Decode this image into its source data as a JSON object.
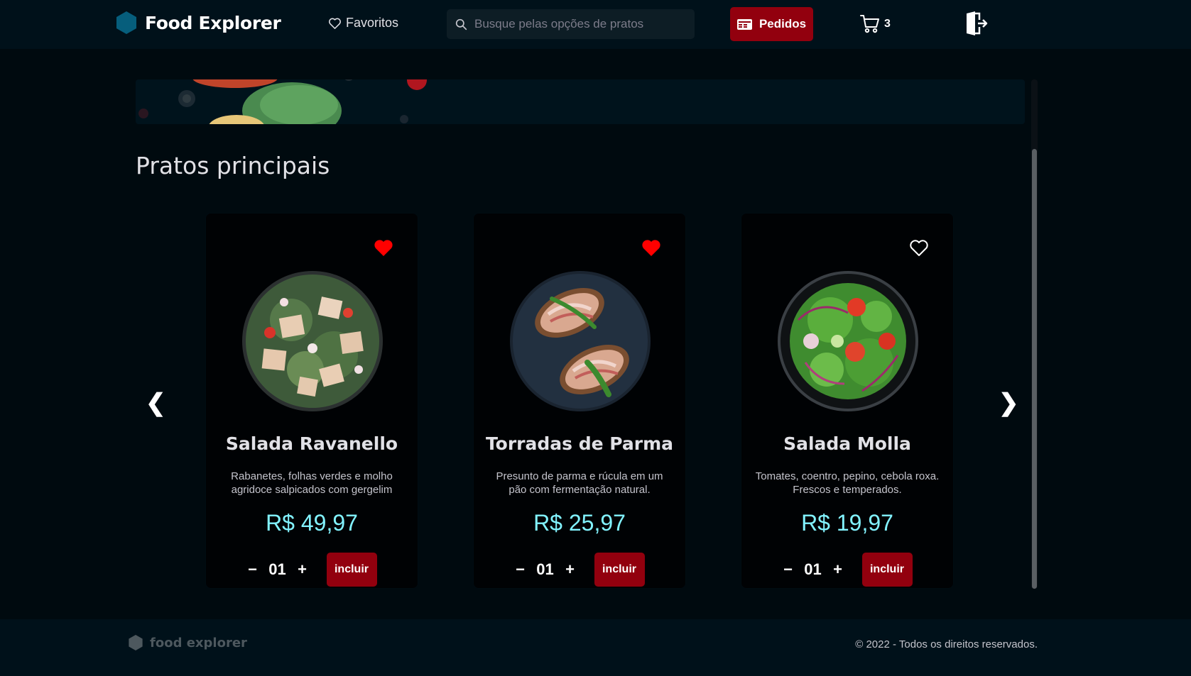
{
  "header": {
    "brand_name": "Food Explorer",
    "favorites_label": "Favoritos",
    "search_placeholder": "Busque pelas opções de pratos",
    "orders_label": "Pedidos",
    "cart_count": "3"
  },
  "section": {
    "title": "Pratos principais",
    "prev_arrow": "❮",
    "next_arrow": "❯"
  },
  "dishes": [
    {
      "name": "Salada Ravanello",
      "description": "Rabanetes, folhas verdes e molho agridoce salpicados com gergelim",
      "price": "R$ 49,97",
      "quantity": "01",
      "add_label": "incluir",
      "favorited": true,
      "decrement": "−",
      "increment": "+"
    },
    {
      "name": "Torradas de Parma",
      "description": "Presunto de parma e rúcula em um pão com fermentação natural.",
      "price": "R$ 25,97",
      "quantity": "01",
      "add_label": "incluir",
      "favorited": true,
      "decrement": "−",
      "increment": "+"
    },
    {
      "name": "Salada Molla",
      "description": "Tomates, coentro, pepino, cebola roxa. Frescos e temperados.",
      "price": "R$ 19,97",
      "quantity": "01",
      "add_label": "incluir",
      "favorited": false,
      "decrement": "−",
      "increment": "+"
    }
  ],
  "footer": {
    "brand_name": "food explorer",
    "copyright": "© 2022 - Todos os direitos reservados."
  },
  "colors": {
    "accent_red": "#92000e",
    "price_cyan": "#82f3ff",
    "brand_blue": "#065e7c",
    "heart_red": "#ff0000"
  },
  "icons": {
    "brand": "hexagon-icon",
    "favorites": "heart-outline-icon",
    "search": "search-icon",
    "orders": "receipt-icon",
    "cart": "cart-icon",
    "logout": "sign-out-icon"
  }
}
